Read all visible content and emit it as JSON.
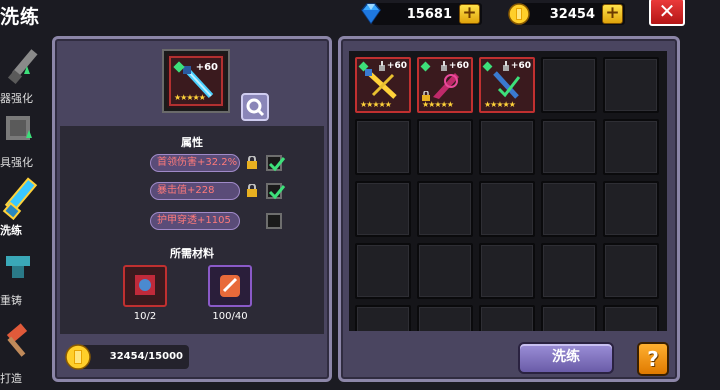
{
  "header": {
    "title": "洗练",
    "gems": "15681",
    "coins": "32454",
    "close_label": "✕",
    "plus_label": "+"
  },
  "tabs": [
    {
      "label": "器强化",
      "active": false
    },
    {
      "label": "具强化",
      "active": false
    },
    {
      "label": "洗练",
      "active": true
    },
    {
      "label": "重铸",
      "active": false
    },
    {
      "label": "打造",
      "active": false
    }
  ],
  "item": {
    "level": "+60",
    "stars": "★★★★★"
  },
  "attributes": {
    "title": "属性",
    "rows": [
      {
        "text": "首领伤害+32.2%",
        "locked": true,
        "checked": true
      },
      {
        "text": "暴击值+228",
        "locked": true,
        "checked": true
      },
      {
        "text": "护甲穿透+1105",
        "locked": false,
        "checked": false
      }
    ]
  },
  "materials": {
    "title": "所需材料",
    "items": [
      {
        "count": "10/2",
        "icon": "blue-stone-icon"
      },
      {
        "count": "100/40",
        "icon": "scroll-icon"
      }
    ]
  },
  "gold_cost": "32454/15000",
  "inventory": [
    {
      "level": "+60",
      "stars": "★★★★★",
      "weapon": "golden-dagger"
    },
    {
      "level": "+60",
      "stars": "★★★★★",
      "weapon": "pink-dagger"
    },
    {
      "level": "+60",
      "stars": "★★★★★",
      "weapon": "blue-dagger"
    }
  ],
  "buttons": {
    "wash": "洗练",
    "help": "?"
  },
  "colors": {
    "panel": "#4a4560",
    "accent_red": "#c03030",
    "gold": "#ffd23a",
    "attr_text": "#ff7a7a"
  }
}
